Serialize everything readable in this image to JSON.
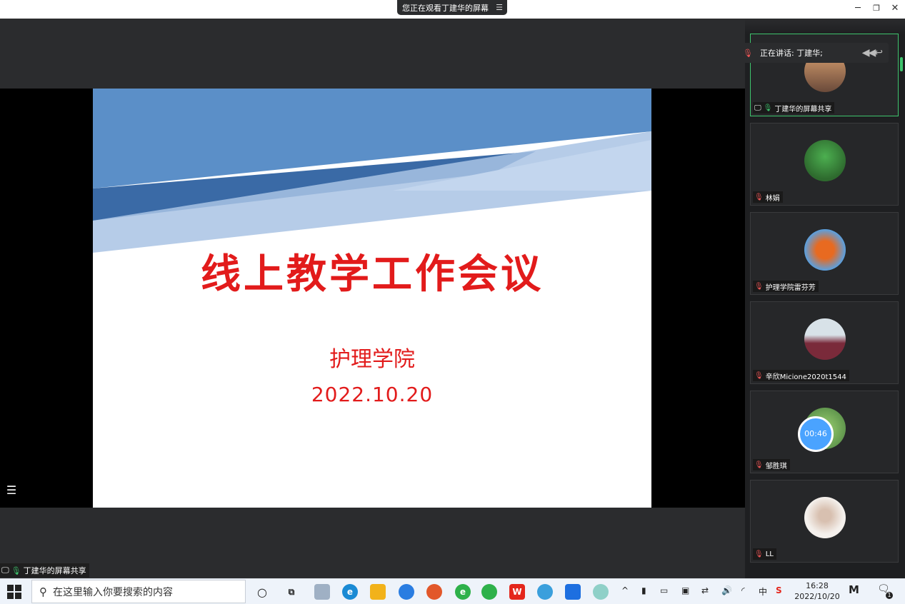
{
  "window": {
    "banner_text": "您正在观看丁建华的屏幕",
    "banner_menu_icon": "hamburger-icon",
    "controls": [
      "minimize-icon",
      "restore-icon",
      "close-icon"
    ]
  },
  "slide": {
    "title": "线上教学工作会议",
    "subtitle": "护理学院",
    "date": "2022.10.20",
    "colors": {
      "dark_blue": "#3a6aa6",
      "mid_blue": "#5b8fc8",
      "light_blue": "#a9c3e4",
      "text_red": "#e21b1b"
    }
  },
  "stage": {
    "share_label": "丁建华的屏幕共享"
  },
  "speaking": {
    "text": "正在讲话: 丁建华;"
  },
  "participants": [
    {
      "name": "丁建华的屏幕共享",
      "active": true,
      "mic": "on",
      "avatar": "pagoda-avatar"
    },
    {
      "name": "林娟",
      "active": false,
      "mic": "muted",
      "avatar": "bird-avatar"
    },
    {
      "name": "护理学院雷芬芳",
      "active": false,
      "mic": "muted",
      "avatar": "berries-avatar"
    },
    {
      "name": "辛欣Micione2020t1544",
      "active": false,
      "mic": "muted",
      "avatar": "person-avatar"
    },
    {
      "name": "邹胜琪",
      "active": false,
      "mic": "muted",
      "avatar": "plant-avatar",
      "timer": "00:46"
    },
    {
      "name": "LL",
      "active": false,
      "mic": "muted",
      "avatar": "girl-avatar"
    }
  ],
  "taskbar": {
    "search_placeholder": "在这里输入你要搜索的内容",
    "time": "16:28",
    "date": "2022/10/20",
    "notification_count": "1",
    "ime": "中",
    "s_icon": "S"
  }
}
